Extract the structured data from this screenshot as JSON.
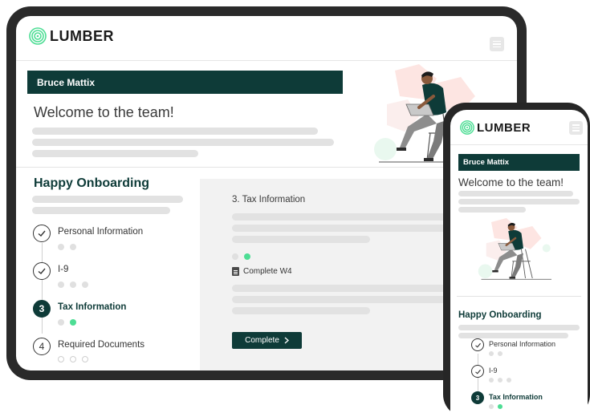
{
  "brand": {
    "name": "LUMBER",
    "logo_icon": "spiral-logo-icon",
    "colors": {
      "primary": "#0e3b38",
      "accent": "#4ddd94",
      "placeholder": "#e2e2e2",
      "panel": "#f2f2f2",
      "illustration_bg": "#fde5e2"
    }
  },
  "header": {
    "menu_icon": "hamburger-menu-icon"
  },
  "user": {
    "name": "Bruce Mattix"
  },
  "welcome": {
    "title": "Welcome to the team!"
  },
  "onboarding": {
    "title": "Happy Onboarding",
    "steps": [
      {
        "number": "1",
        "label": "Personal Information",
        "status": "complete",
        "icon": "check-circle-icon"
      },
      {
        "number": "2",
        "label": "I-9",
        "status": "complete",
        "icon": "check-circle-icon"
      },
      {
        "number": "3",
        "label": "Tax Information",
        "status": "active"
      },
      {
        "number": "4",
        "label": "Required Documents",
        "status": "pending"
      }
    ]
  },
  "panel": {
    "title": "3. Tax Information",
    "task": {
      "label": "Complete W4",
      "icon": "clipboard-icon"
    },
    "button": {
      "label": "Complete",
      "icon": "chevron-right-icon"
    }
  },
  "illustration": {
    "icon": "person-with-laptop-illustration"
  }
}
